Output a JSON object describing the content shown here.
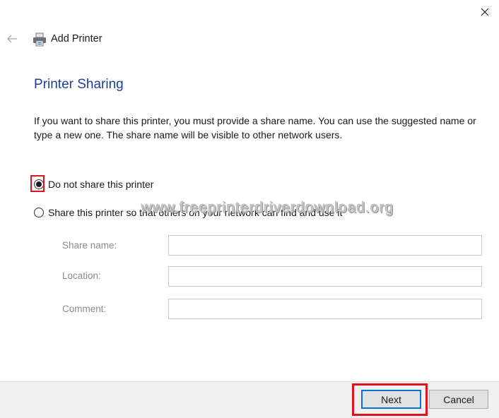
{
  "window": {
    "title": "Add Printer",
    "close_icon": "close-icon",
    "back_icon": "back-arrow-icon",
    "app_icon": "printer-icon"
  },
  "page": {
    "heading": "Printer Sharing",
    "description": "If you want to share this printer, you must provide a share name. You can use the suggested name or type a new one. The share name will be visible to other network users."
  },
  "options": [
    {
      "label": "Do not share this printer",
      "selected": true
    },
    {
      "label": "Share this printer so that others on your network can find and use it",
      "selected": false
    }
  ],
  "fields": [
    {
      "label": "Share name:",
      "value": ""
    },
    {
      "label": "Location:",
      "value": ""
    },
    {
      "label": "Comment:",
      "value": ""
    }
  ],
  "buttons": {
    "next": "Next",
    "cancel": "Cancel"
  },
  "watermark": "www.freeprinterdriverdownload.org",
  "colors": {
    "heading": "#1e3c9a",
    "highlight": "#e0141f",
    "focus": "#0a72d1"
  }
}
